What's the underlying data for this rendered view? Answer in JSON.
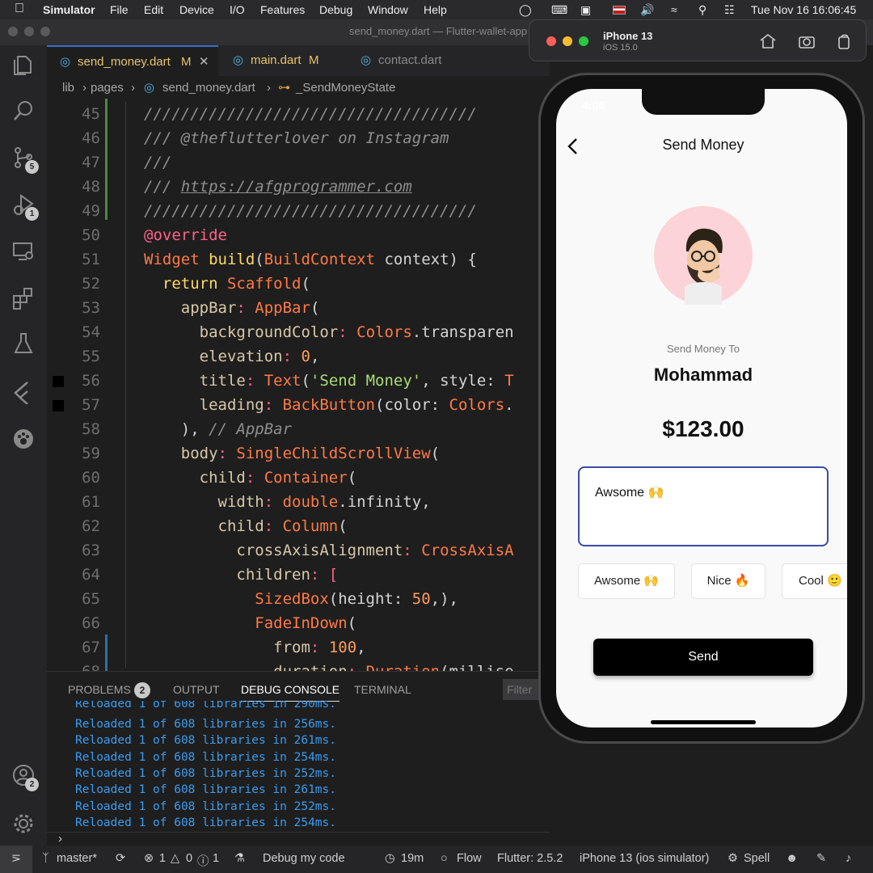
{
  "menubar": {
    "app": "Simulator",
    "items": [
      "File",
      "Edit",
      "Device",
      "I/O",
      "Features",
      "Debug",
      "Window",
      "Help"
    ],
    "clock": "Tue Nov 16  16:06:45"
  },
  "window": {
    "title": "send_money.dart — Flutter-wallet-app"
  },
  "activity": {
    "scm_badge": "5",
    "debug_badge": "1",
    "accounts_badge": "2"
  },
  "tabs": [
    {
      "label": "send_money.dart",
      "mod": "M"
    },
    {
      "label": "main.dart",
      "mod": "M"
    },
    {
      "label": "contact.dart"
    }
  ],
  "breadcrumb": [
    "lib",
    "pages",
    "send_money.dart",
    "_SendMoneyState"
  ],
  "line_numbers": [
    "45",
    "46",
    "47",
    "48",
    "49",
    "50",
    "51",
    "52",
    "53",
    "54",
    "55",
    "56",
    "57",
    "58",
    "59",
    "60",
    "61",
    "62",
    "63",
    "64",
    "65",
    "66",
    "67",
    "68"
  ],
  "code": {
    "l45": "////////////////////////////////////",
    "l46": "/// @theflutterlover on Instagram",
    "l47": "///",
    "l48a": "/// ",
    "l48b": "https://afgprogrammer.com",
    "l49": "////////////////////////////////////",
    "l50": "@override",
    "l51a": "Widget",
    "l51b": "build",
    "l51c": "(",
    "l51d": "BuildContext",
    "l51e": " context) {",
    "l52a": "return",
    "l52b": "Scaffold",
    "l52c": "(",
    "l53a": "appBar",
    "l53b": ": ",
    "l53c": "AppBar",
    "l53d": "(",
    "l54a": "backgroundColor",
    "l54b": ": ",
    "l54c": "Colors",
    "l54d": ".transparen",
    "l55a": "elevation",
    "l55b": ": ",
    "l55c": "0",
    "l55d": ",",
    "l56a": "title",
    "l56b": ": ",
    "l56c": "Text",
    "l56d": "(",
    "l56e": "'Send Money'",
    "l56f": ", style: ",
    "l56g": "T",
    "l57a": "leading",
    "l57b": ": ",
    "l57c": "BackButton",
    "l57d": "(color: ",
    "l57e": "Colors",
    "l57f": ".",
    "l58a": "), ",
    "l58b": "// AppBar",
    "l59a": "body",
    "l59b": ": ",
    "l59c": "SingleChildScrollView",
    "l59d": "(",
    "l60a": "child",
    "l60b": ": ",
    "l60c": "Container",
    "l60d": "(",
    "l61a": "width",
    "l61b": ": ",
    "l61c": "double",
    "l61d": ".infinity,",
    "l62a": "child",
    "l62b": ": ",
    "l62c": "Column",
    "l62d": "(",
    "l63a": "crossAxisAlignment",
    "l63b": ": ",
    "l63c": "CrossAxisA",
    "l64a": "children",
    "l64b": ": [",
    "l65a": "SizedBox",
    "l65b": "(height: ",
    "l65c": "50",
    "l65d": ",),",
    "l66a": "FadeInDown",
    "l66b": "(",
    "l67a": "from",
    "l67b": ": ",
    "l67c": "100",
    "l67d": ",",
    "l68a": "duration",
    "l68b": ": ",
    "l68c": "Duration",
    "l68d": "(millise"
  },
  "panel": {
    "tabs": [
      "PROBLEMS",
      "OUTPUT",
      "DEBUG CONSOLE",
      "TERMINAL"
    ],
    "problems_count": "2",
    "filter_placeholder": "Filter",
    "logs": [
      "Reloaded 1 of 608 libraries in 290ms.",
      "Reloaded 1 of 608 libraries in 256ms.",
      "Reloaded 1 of 608 libraries in 261ms.",
      "Reloaded 1 of 608 libraries in 254ms.",
      "Reloaded 1 of 608 libraries in 252ms.",
      "Reloaded 1 of 608 libraries in 261ms.",
      "Reloaded 1 of 608 libraries in 252ms.",
      "Reloaded 1 of 608 libraries in 254ms."
    ]
  },
  "statusbar": {
    "branch": "master*",
    "errors": "1",
    "warnings": "0",
    "infos": "1",
    "debug": "Debug my code",
    "time": "19m",
    "flow": "Flow",
    "flutter": "Flutter: 2.5.2",
    "device": "iPhone 13 (ios simulator)",
    "spell": "Spell"
  },
  "simulator": {
    "device": "iPhone 13",
    "os": "iOS 15.0",
    "clock": "4:06"
  },
  "app": {
    "title": "Send Money",
    "send_to_label": "Send Money To",
    "recipient": "Mohammad",
    "amount": "$123.00",
    "note": "Awsome 🙌",
    "chips": [
      "Awsome 🙌",
      "Nice 🔥",
      "Cool 🙂"
    ],
    "send_label": "Send"
  },
  "colors": {
    "accent": "#3b4aa8",
    "comment": "#8f8f8f",
    "keyword": "#ff6188",
    "function": "#ffd866",
    "log": "#3a9cf0"
  }
}
